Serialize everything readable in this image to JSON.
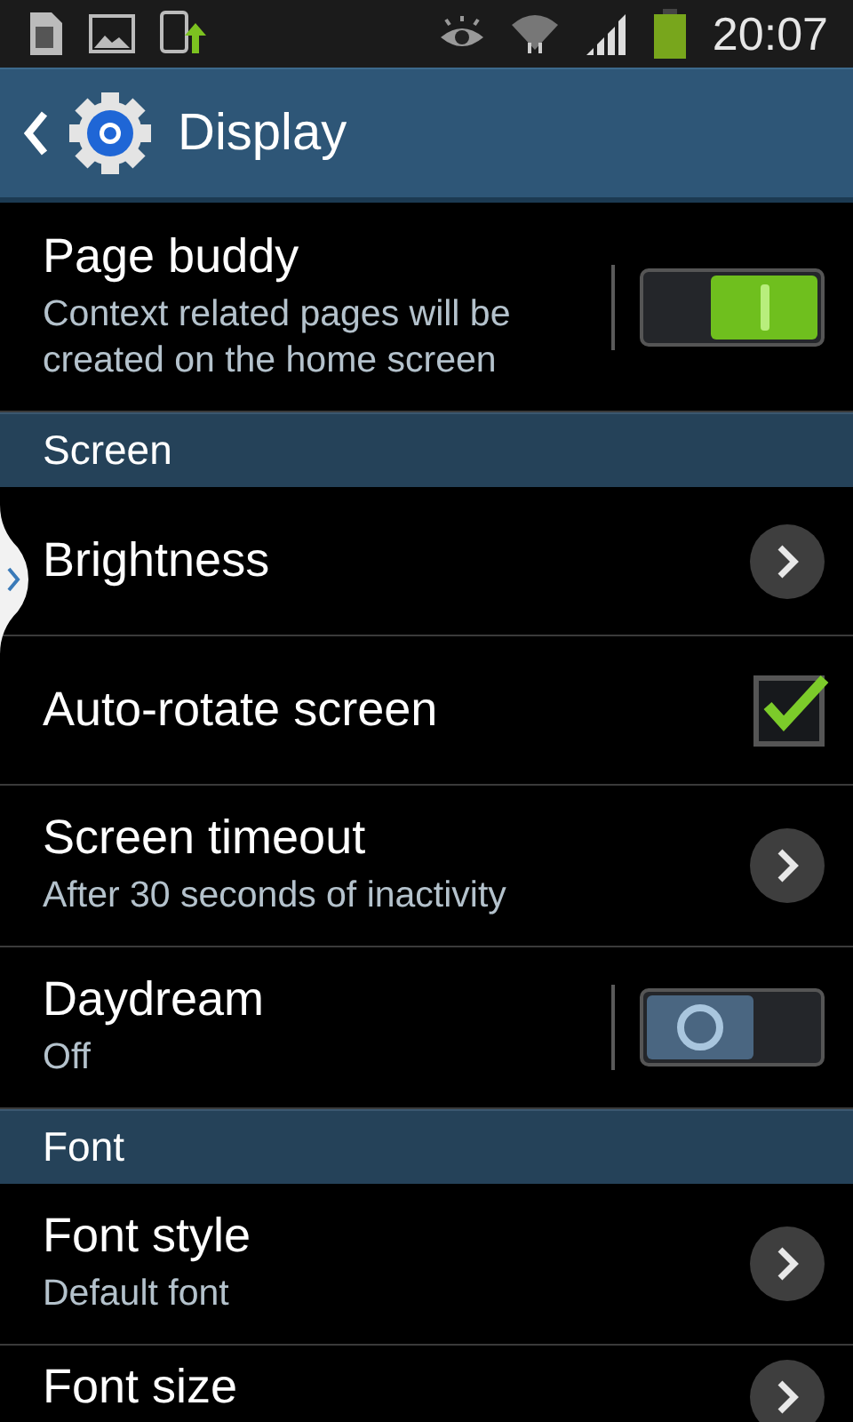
{
  "status_bar": {
    "time": "20:07"
  },
  "action_bar": {
    "title": "Display"
  },
  "sections": [
    {
      "items": [
        {
          "kind": "toggle",
          "title": "Page buddy",
          "summary": "Context related pages will be created on the home screen",
          "on": true
        }
      ]
    },
    {
      "header": "Screen",
      "items": [
        {
          "kind": "chevron",
          "title": "Brightness"
        },
        {
          "kind": "checkbox",
          "title": "Auto-rotate screen",
          "checked": true
        },
        {
          "kind": "chevron",
          "title": "Screen timeout",
          "summary": "After 30 seconds of inactivity"
        },
        {
          "kind": "toggle",
          "title": "Daydream",
          "summary": "Off",
          "on": false
        }
      ]
    },
    {
      "header": "Font",
      "items": [
        {
          "kind": "chevron",
          "title": "Font style",
          "summary": "Default font"
        },
        {
          "kind": "chevron",
          "title": "Font size"
        }
      ]
    }
  ]
}
